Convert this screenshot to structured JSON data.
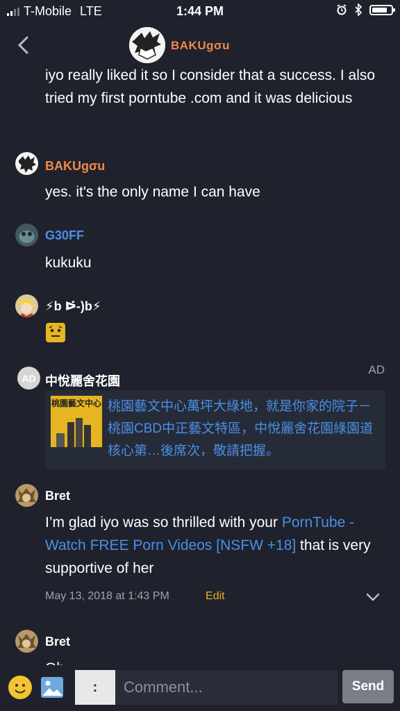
{
  "status_bar": {
    "carrier": "T-Mobile",
    "network": "LTE",
    "time": "1:44 PM",
    "signal_bars": 2,
    "battery_level": 0.8,
    "icons": [
      "alarm-icon",
      "bluetooth-icon",
      "battery-icon"
    ]
  },
  "header": {
    "back_icon": "chevron-left-icon",
    "title": "BAKUgσu"
  },
  "messages": [
    {
      "author": "",
      "text": "iyo really liked it so I consider that a success. I also tried my first porntube .com and it was delicious"
    },
    {
      "author": "BAKUgσu",
      "text": "yes. it's the only name I can have"
    },
    {
      "author": "G30FF",
      "text": "kukuku"
    },
    {
      "author": "⚡b ᐅ̇-)b⚡",
      "text": "",
      "sticker": "emoji-face-icon"
    }
  ],
  "ad": {
    "label": "AD",
    "avatar_text": "AD",
    "advertiser": "中悅麗舍花園",
    "thumb_title": "桃園藝文中心",
    "text": "桃園藝文中心萬坪大綠地，就是你家的院子－桃園CBD中正藝文特區，中悅麗舍花園綠園道核心第…後席次，敬請把握。"
  },
  "bret_message": {
    "author": "Bret",
    "text_before": "I’m glad iyo was so thrilled with your ",
    "link": "PornTube - Watch FREE Porn Videos [NSFW +18]",
    "text_after": " that is very supportive of her",
    "timestamp": "May 13, 2018 at 1:43 PM",
    "edit_label": "Edit"
  },
  "bret_message_2": {
    "author": "Bret",
    "text": "Ob"
  },
  "composer": {
    "colon_label": ":",
    "placeholder": "Comment...",
    "send_label": "Send"
  },
  "colors": {
    "background": "#1f222c",
    "orange_name": "#f2884b",
    "blue_name": "#4a8fe7",
    "edit": "#e6b521"
  }
}
